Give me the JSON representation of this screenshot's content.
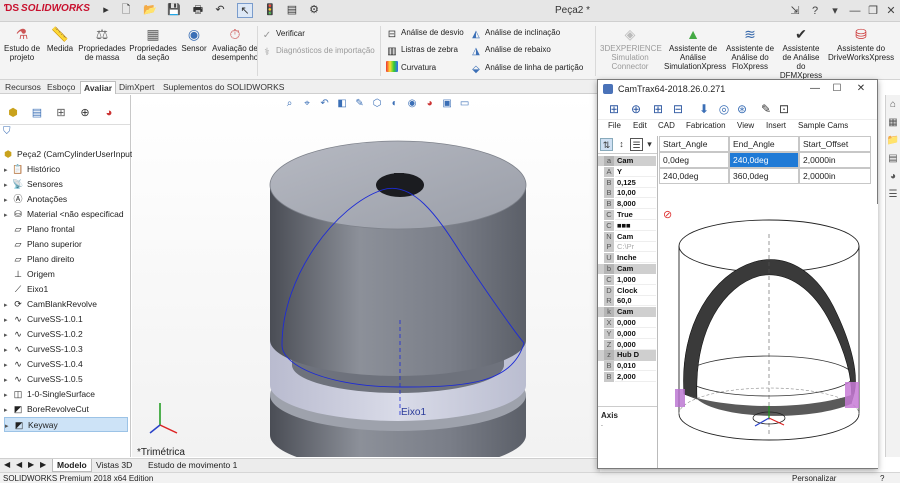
{
  "app": {
    "name": "SOLIDWORKS",
    "document_title": "Peça2 *",
    "edition_status": "SOLIDWORKS Premium 2018 x64 Edition",
    "customize_label": "Personalizar"
  },
  "ribbon": {
    "big_buttons": [
      {
        "label": "Estudo de projeto",
        "icon": "design-study-icon"
      },
      {
        "label": "Medida",
        "icon": "measure-icon"
      },
      {
        "label": "Propriedades de massa",
        "icon": "mass-properties-icon"
      },
      {
        "label": "Propriedades da seção",
        "icon": "section-properties-icon"
      },
      {
        "label": "Sensor",
        "icon": "sensor-icon"
      },
      {
        "label": "Avaliação de desempenho",
        "icon": "performance-icon"
      }
    ],
    "verify_label": "Verificar",
    "import_diag_label": "Diagnósticos de importação",
    "analysis_col1": [
      "Análise de desvio",
      "Listras de zebra",
      "Curvatura"
    ],
    "analysis_col2": [
      "Análise de inclinação",
      "Análise de rebaixo",
      "Análise de linha de partição"
    ],
    "right_buttons": [
      {
        "label": "3DEXPERIENCE Simulation Connector",
        "disabled": true
      },
      {
        "label": "Assistente de Análise SimulationXpress",
        "disabled": false
      },
      {
        "label": "Assistente de Análise do FloXpress",
        "disabled": false
      },
      {
        "label": "Assistente de Análise do DFMXpress",
        "disabled": false
      },
      {
        "label": "Assistente do DriveWorksXpress",
        "disabled": false
      }
    ]
  },
  "tabs": [
    "Recursos",
    "Esboço",
    "Avaliar",
    "DimXpert",
    "Suplementos do SOLIDWORKS"
  ],
  "active_tab": "Avaliar",
  "tree": {
    "root": "Peça2  (CamCylinderUserInput",
    "items": [
      {
        "label": "Histórico",
        "icon": "history-icon"
      },
      {
        "label": "Sensores",
        "icon": "sensors-icon"
      },
      {
        "label": "Anotações",
        "icon": "annotations-icon"
      },
      {
        "label": "Material <não especificad",
        "icon": "material-icon"
      },
      {
        "label": "Plano frontal",
        "icon": "plane-icon"
      },
      {
        "label": "Plano superior",
        "icon": "plane-icon"
      },
      {
        "label": "Plano direito",
        "icon": "plane-icon"
      },
      {
        "label": "Origem",
        "icon": "origin-icon"
      },
      {
        "label": "Eixo1",
        "icon": "axis-icon"
      },
      {
        "label": "CamBlankRevolve",
        "icon": "revolve-icon"
      },
      {
        "label": "CurveSS-1.0.1",
        "icon": "curve-icon"
      },
      {
        "label": "CurveSS-1.0.2",
        "icon": "curve-icon"
      },
      {
        "label": "CurveSS-1.0.3",
        "icon": "curve-icon"
      },
      {
        "label": "CurveSS-1.0.4",
        "icon": "curve-icon"
      },
      {
        "label": "CurveSS-1.0.5",
        "icon": "curve-icon"
      },
      {
        "label": "1-0-SingleSurface",
        "icon": "surface-icon"
      },
      {
        "label": "BoreRevolveCut",
        "icon": "cut-icon"
      },
      {
        "label": "Keyway",
        "icon": "cut-icon"
      }
    ]
  },
  "viewport": {
    "view_label": "*Trimétrica",
    "axis_label": "Eixo1"
  },
  "bottom_tabs": [
    "Modelo",
    "Vistas 3D",
    "Estudo de movimento 1"
  ],
  "camtrax": {
    "title": "CamTrax64-2018.26.0.271",
    "menu": [
      "File",
      "Edit",
      "CAD",
      "Fabrication",
      "View",
      "Insert",
      "Sample Cams"
    ],
    "grid_headers": [
      "Start_Angle",
      "End_Angle",
      "Start_Offset"
    ],
    "grid_rows": [
      [
        "0,0deg",
        "240,0deg",
        "2,0000in"
      ],
      [
        "240,0deg",
        "360,0deg",
        "2,0000in"
      ]
    ],
    "props": [
      {
        "key": "a",
        "value": "Cam",
        "header": true
      },
      {
        "key": "A",
        "value": "Y"
      },
      {
        "key": "B",
        "value": "0,125"
      },
      {
        "key": "B",
        "value": "10,00"
      },
      {
        "key": "B",
        "value": "8,000"
      },
      {
        "key": "C",
        "value": "True"
      },
      {
        "key": "C",
        "value": "■■■"
      },
      {
        "key": "N",
        "value": "Cam"
      },
      {
        "key": "P",
        "value": "C:\\Pr",
        "gray": true
      },
      {
        "key": "U",
        "value": "Inche"
      },
      {
        "key": "b",
        "value": "Cam",
        "header": true
      },
      {
        "key": "C",
        "value": "1,000"
      },
      {
        "key": "D",
        "value": "Clock"
      },
      {
        "key": "R",
        "value": "60,0"
      },
      {
        "key": "k",
        "value": "Cam",
        "header": true
      },
      {
        "key": "X",
        "value": "0,000"
      },
      {
        "key": "Y",
        "value": "0,000"
      },
      {
        "key": "Z",
        "value": "0,000"
      },
      {
        "key": "z",
        "value": "Hub D",
        "header": true
      },
      {
        "key": "B",
        "value": "0,010"
      },
      {
        "key": "B",
        "value": "2,000"
      }
    ],
    "axis_title": "Axis",
    "axis_desc": "."
  },
  "colors": {
    "accent": "#1f7ad6",
    "solidworks_red": "#c8102e",
    "cam_path": "#1d2bd6"
  }
}
